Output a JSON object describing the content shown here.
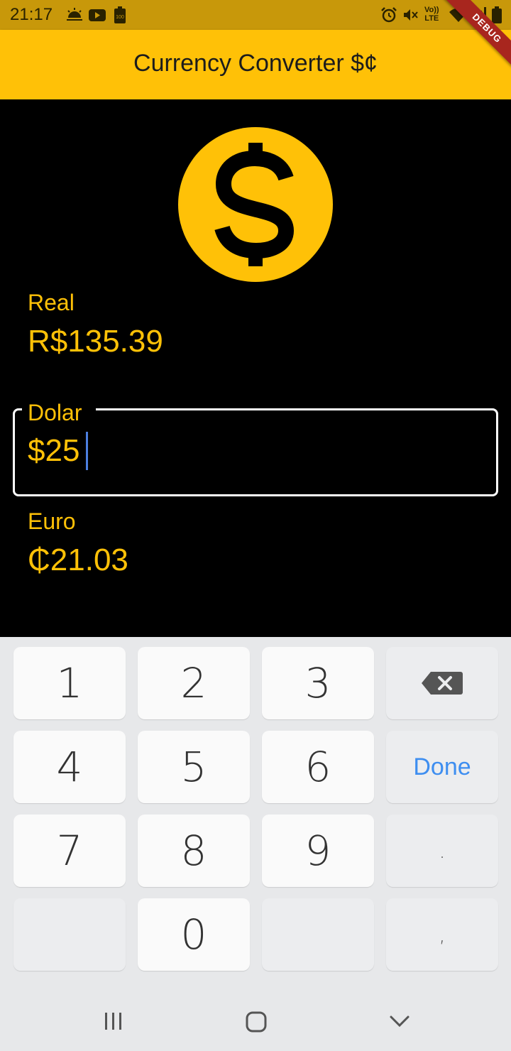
{
  "status_bar": {
    "time": "21:17",
    "left_icons": [
      "weather-sunrise-icon",
      "youtube-icon",
      "battery-saver-icon"
    ],
    "battery_saver_text": "100",
    "right_icons": [
      "alarm-icon",
      "mute-icon",
      "volte-icon",
      "wifi-icon",
      "signal-icon",
      "battery-icon"
    ],
    "volte_top": "Vo))",
    "volte_bottom": "LTE"
  },
  "debug_banner": "DEBUG",
  "app_bar": {
    "title": "Currency Converter $¢",
    "color": "#FFC107"
  },
  "main": {
    "logo_icon": "dollar-circle-icon",
    "real": {
      "label": "Real",
      "value": "R$135.39"
    },
    "dolar": {
      "label": "Dolar",
      "value": "$25",
      "focused": true
    },
    "euro": {
      "label": "Euro",
      "value": "₵21.03"
    }
  },
  "keyboard": {
    "row1": [
      "1",
      "2",
      "3"
    ],
    "row2": [
      "4",
      "5",
      "6"
    ],
    "row3": [
      "7",
      "8",
      "9"
    ],
    "row4": [
      "0"
    ],
    "backspace_icon": "backspace-icon",
    "done_label": "Done",
    "dot_label": ".",
    "comma_label": ",",
    "done_color": "#3E8EF0"
  },
  "nav_bar": {
    "recents_icon": "recents-icon",
    "home_icon": "home-icon",
    "back_icon": "hide-keyboard-icon"
  }
}
